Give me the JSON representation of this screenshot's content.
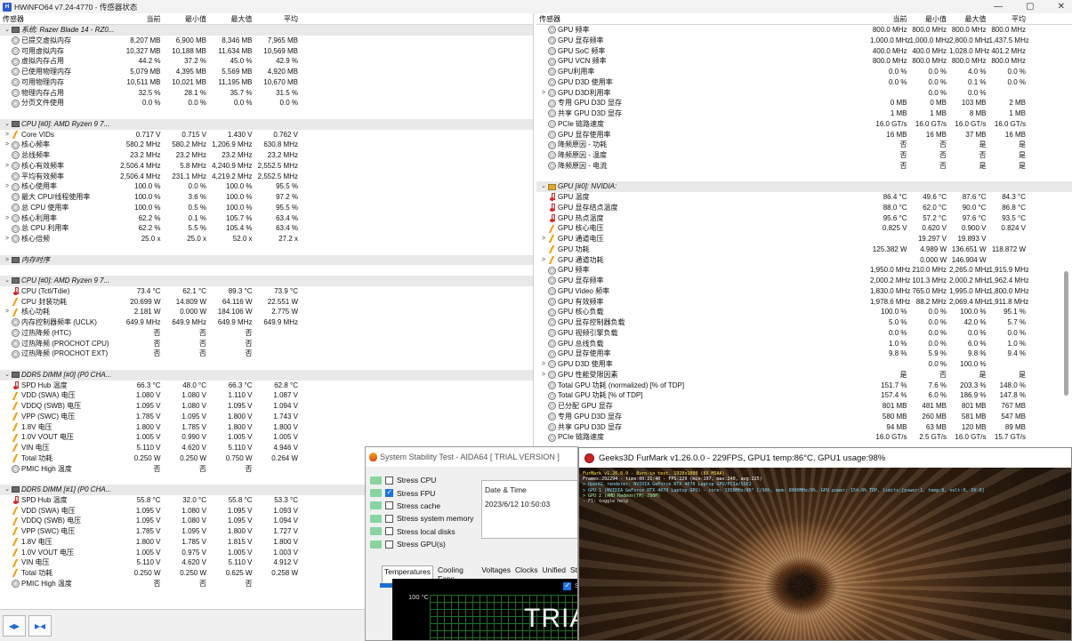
{
  "titlebar": {
    "app_title": "HWiNFO64 v7.24-4770 - 传感器状态",
    "minimize": "—",
    "maximize": "▢",
    "close": "✕"
  },
  "columns": {
    "name": "传感器",
    "current": "当前",
    "min": "最小值",
    "max": "最大值",
    "avg": "平均"
  },
  "left_rows": [
    {
      "type": "section",
      "name": "系统: Razer Blade 14 - RZ0..."
    },
    {
      "icon": "circle",
      "name": "已提交虚拟内存",
      "v": [
        "8,207 MB",
        "6,900 MB",
        "8,346 MB",
        "7,965 MB"
      ]
    },
    {
      "icon": "circle",
      "name": "可用虚拟内存",
      "v": [
        "10,327 MB",
        "10,188 MB",
        "11,634 MB",
        "10,569 MB"
      ]
    },
    {
      "icon": "circle",
      "name": "虚拟内存占用",
      "v": [
        "44.2 %",
        "37.2 %",
        "45.0 %",
        "42.9 %"
      ]
    },
    {
      "icon": "circle",
      "name": "已使用物理内存",
      "v": [
        "5,079 MB",
        "4,395 MB",
        "5,569 MB",
        "4,920 MB"
      ]
    },
    {
      "icon": "circle",
      "name": "可用物理内存",
      "v": [
        "10,511 MB",
        "10,021 MB",
        "11,195 MB",
        "10,670 MB"
      ]
    },
    {
      "icon": "circle",
      "name": "物理内存占用",
      "v": [
        "32.5 %",
        "28.1 %",
        "35.7 %",
        "31.5 %"
      ]
    },
    {
      "icon": "circle",
      "name": "分页文件使用",
      "v": [
        "0.0 %",
        "0.0 %",
        "0.0 %",
        "0.0 %"
      ]
    },
    {
      "type": "blank"
    },
    {
      "type": "section",
      "name": "CPU [#0]: AMD Ryzen 9 7..."
    },
    {
      "exp": ">",
      "icon": "bolt",
      "name": "Core VIDs",
      "v": [
        "0.717 V",
        "0.715 V",
        "1.430 V",
        "0.762 V"
      ]
    },
    {
      "exp": ">",
      "icon": "circle",
      "name": "核心频率",
      "v": [
        "580.2 MHz",
        "580.2 MHz",
        "1,206.9 MHz",
        "630.8 MHz"
      ]
    },
    {
      "icon": "circle",
      "name": "总线频率",
      "v": [
        "23.2 MHz",
        "23.2 MHz",
        "23.2 MHz",
        "23.2 MHz"
      ]
    },
    {
      "exp": ">",
      "icon": "circle",
      "name": "核心有效频率",
      "v": [
        "2,506.4 MHz",
        "5.8 MHz",
        "4,240.9 MHz",
        "2,552.5 MHz"
      ]
    },
    {
      "icon": "circle",
      "name": "平均有效频率",
      "v": [
        "2,506.4 MHz",
        "231.1 MHz",
        "4,219.2 MHz",
        "2,552.5 MHz"
      ]
    },
    {
      "exp": ">",
      "icon": "circle",
      "name": "核心使用率",
      "v": [
        "100.0 %",
        "0.0 %",
        "100.0 %",
        "95.5 %"
      ]
    },
    {
      "icon": "circle",
      "name": "最大 CPU/线程使用率",
      "v": [
        "100.0 %",
        "3.6 %",
        "100.0 %",
        "97.2 %"
      ]
    },
    {
      "icon": "circle",
      "name": "总 CPU 使用率",
      "v": [
        "100.0 %",
        "0.5 %",
        "100.0 %",
        "95.5 %"
      ]
    },
    {
      "exp": ">",
      "icon": "circle",
      "name": "核心利用率",
      "v": [
        "62.2 %",
        "0.1 %",
        "105.7 %",
        "63.4 %"
      ]
    },
    {
      "icon": "circle",
      "name": "总 CPU 利用率",
      "v": [
        "62.2 %",
        "5.5 %",
        "105.4 %",
        "63.4 %"
      ]
    },
    {
      "exp": ">",
      "icon": "circle",
      "name": "核心倍频",
      "v": [
        "25.0 x",
        "25.0 x",
        "52.0 x",
        "27.2 x"
      ]
    },
    {
      "type": "blank"
    },
    {
      "type": "section",
      "exp": ">",
      "icon": "mem",
      "name": "内存时序"
    },
    {
      "type": "blank"
    },
    {
      "type": "section",
      "name": "CPU [#0]: AMD Ryzen 9 7..."
    },
    {
      "icon": "thermo",
      "name": "CPU (Tctl/Tdie)",
      "v": [
        "73.4 °C",
        "62.1 °C",
        "89.3 °C",
        "73.9 °C"
      ]
    },
    {
      "icon": "bolt",
      "name": "CPU 封装功耗",
      "v": [
        "20.699 W",
        "14.809 W",
        "64.116 W",
        "22.551 W"
      ]
    },
    {
      "exp": ">",
      "icon": "bolt",
      "name": "核心功耗",
      "v": [
        "2.181 W",
        "0.000 W",
        "184.106 W",
        "2.775 W"
      ]
    },
    {
      "icon": "circle",
      "name": "内存控制器频率 (UCLK)",
      "v": [
        "649.9 MHz",
        "649.9 MHz",
        "649.9 MHz",
        "649.9 MHz"
      ]
    },
    {
      "icon": "circle",
      "name": "过热降频 (HTC)",
      "v": [
        "否",
        "否",
        "否",
        ""
      ]
    },
    {
      "icon": "circle",
      "name": "过热降频 (PROCHOT CPU)",
      "v": [
        "否",
        "否",
        "否",
        ""
      ]
    },
    {
      "icon": "circle",
      "name": "过热降频 (PROCHOT EXT)",
      "v": [
        "否",
        "否",
        "否",
        ""
      ]
    },
    {
      "type": "blank"
    },
    {
      "type": "section",
      "name": "DDR5 DIMM [#0] (P0 CHA..."
    },
    {
      "icon": "thermo",
      "name": "SPD Hub 温度",
      "v": [
        "66.3 °C",
        "48.0 °C",
        "66.3 °C",
        "62.8 °C"
      ]
    },
    {
      "icon": "bolt",
      "name": "VDD (SWA) 电压",
      "v": [
        "1.080 V",
        "1.080 V",
        "1.110 V",
        "1.087 V"
      ]
    },
    {
      "icon": "bolt",
      "name": "VDDQ (SWB) 电压",
      "v": [
        "1.095 V",
        "1.080 V",
        "1.095 V",
        "1.094 V"
      ]
    },
    {
      "icon": "bolt",
      "name": "VPP (SWC) 电压",
      "v": [
        "1.785 V",
        "1.095 V",
        "1.800 V",
        "1.743 V"
      ]
    },
    {
      "icon": "bolt",
      "name": "1.8V 电压",
      "v": [
        "1.800 V",
        "1.785 V",
        "1.800 V",
        "1.800 V"
      ]
    },
    {
      "icon": "bolt",
      "name": "1.0V VOUT 电压",
      "v": [
        "1.005 V",
        "0.990 V",
        "1.005 V",
        "1.005 V"
      ]
    },
    {
      "icon": "bolt",
      "name": "VIN 电压",
      "v": [
        "5.110 V",
        "4.620 V",
        "5.110 V",
        "4.946 V"
      ]
    },
    {
      "icon": "bolt",
      "name": "Total 功耗",
      "v": [
        "0.250 W",
        "0.250 W",
        "0.750 W",
        "0.264 W"
      ]
    },
    {
      "icon": "circle",
      "name": "PMIC High 温度",
      "v": [
        "否",
        "否",
        "否",
        ""
      ]
    },
    {
      "type": "blank"
    },
    {
      "type": "section",
      "name": "DDR5 DIMM [#1] (P0 CHA..."
    },
    {
      "icon": "thermo",
      "name": "SPD Hub 温度",
      "v": [
        "55.8 °C",
        "32.0 °C",
        "55.8 °C",
        "53.3 °C"
      ]
    },
    {
      "icon": "bolt",
      "name": "VDD (SWA) 电压",
      "v": [
        "1.095 V",
        "1.080 V",
        "1.095 V",
        "1.093 V"
      ]
    },
    {
      "icon": "bolt",
      "name": "VDDQ (SWB) 电压",
      "v": [
        "1.095 V",
        "1.080 V",
        "1.095 V",
        "1.094 V"
      ]
    },
    {
      "icon": "bolt",
      "name": "VPP (SWC) 电压",
      "v": [
        "1.785 V",
        "1.095 V",
        "1.800 V",
        "1.727 V"
      ]
    },
    {
      "icon": "bolt",
      "name": "1.8V 电压",
      "v": [
        "1.800 V",
        "1.785 V",
        "1.815 V",
        "1.800 V"
      ]
    },
    {
      "icon": "bolt",
      "name": "1.0V VOUT 电压",
      "v": [
        "1.005 V",
        "0.975 V",
        "1.005 V",
        "1.003 V"
      ]
    },
    {
      "icon": "bolt",
      "name": "VIN 电压",
      "v": [
        "5.110 V",
        "4.620 V",
        "5.110 V",
        "4.912 V"
      ]
    },
    {
      "icon": "bolt",
      "name": "Total 功耗",
      "v": [
        "0.250 W",
        "0.250 W",
        "0.625 W",
        "0.258 W"
      ]
    },
    {
      "icon": "circle",
      "name": "PMIC High 温度",
      "v": [
        "否",
        "否",
        "否",
        ""
      ]
    }
  ],
  "right_rows": [
    {
      "icon": "circle",
      "name": "GPU 频率",
      "v": [
        "800.0 MHz",
        "800.0 MHz",
        "800.0 MHz",
        "800.0 MHz"
      ]
    },
    {
      "icon": "circle",
      "name": "GPU 显存频率",
      "v": [
        "1,000.0 MHz",
        "1,000.0 MHz",
        "2,800.0 MHz",
        "1,437.5 MHz"
      ]
    },
    {
      "icon": "circle",
      "name": "GPU SoC 频率",
      "v": [
        "400.0 MHz",
        "400.0 MHz",
        "1,028.0 MHz",
        "401.2 MHz"
      ]
    },
    {
      "icon": "circle",
      "name": "GPU VCN 频率",
      "v": [
        "800.0 MHz",
        "800.0 MHz",
        "800.0 MHz",
        "800.0 MHz"
      ]
    },
    {
      "icon": "circle",
      "name": "GPU利用率",
      "v": [
        "0.0 %",
        "0.0 %",
        "4.0 %",
        "0.0 %"
      ]
    },
    {
      "icon": "circle",
      "name": "GPU D3D 使用率",
      "v": [
        "0.0 %",
        "0.0 %",
        "0.1 %",
        "0.0 %"
      ]
    },
    {
      "exp": ">",
      "icon": "circle",
      "name": "GPU D3D利用率",
      "v": [
        "",
        "0.0 %",
        "0.0 %",
        ""
      ]
    },
    {
      "icon": "circle",
      "name": "专用 GPU D3D 显存",
      "v": [
        "0 MB",
        "0 MB",
        "103 MB",
        "2 MB"
      ]
    },
    {
      "icon": "circle",
      "name": "共享 GPU D3D 显存",
      "v": [
        "1 MB",
        "1 MB",
        "8 MB",
        "1 MB"
      ]
    },
    {
      "icon": "circle",
      "name": "PCIe 链路速度",
      "v": [
        "16.0 GT/s",
        "16.0 GT/s",
        "16.0 GT/s",
        "16.0 GT/s"
      ]
    },
    {
      "icon": "circle",
      "name": "GPU 显存使用率",
      "v": [
        "16 MB",
        "16 MB",
        "37 MB",
        "16 MB"
      ]
    },
    {
      "icon": "circle",
      "name": "降频原因 - 功耗",
      "v": [
        "否",
        "否",
        "是",
        "是"
      ]
    },
    {
      "icon": "circle",
      "name": "降频原因 - 温度",
      "v": [
        "否",
        "否",
        "否",
        "是"
      ]
    },
    {
      "icon": "circle",
      "name": "降频原因 - 电流",
      "v": [
        "否",
        "否",
        "是",
        "是"
      ]
    },
    {
      "type": "blank"
    },
    {
      "type": "section",
      "exp": "v",
      "icon": "fold",
      "name": "GPU [#0]: NVIDIA:"
    },
    {
      "icon": "thermo",
      "name": "GPU 温度",
      "v": [
        "86.4 °C",
        "49.6 °C",
        "87.6 °C",
        "84.3 °C"
      ]
    },
    {
      "icon": "thermo",
      "name": "GPU 显存结点温度",
      "v": [
        "88.0 °C",
        "62.0 °C",
        "90.0 °C",
        "86.8 °C"
      ]
    },
    {
      "icon": "thermo",
      "name": "GPU 热点温度",
      "v": [
        "95.6 °C",
        "57.2 °C",
        "97.6 °C",
        "93.5 °C"
      ]
    },
    {
      "icon": "bolt",
      "name": "GPU 核心电压",
      "v": [
        "0.825 V",
        "0.620 V",
        "0.900 V",
        "0.824 V"
      ]
    },
    {
      "exp": ">",
      "icon": "bolt",
      "name": "GPU 通道电压",
      "v": [
        "",
        "19.297 V",
        "19.893 V",
        ""
      ]
    },
    {
      "icon": "bolt",
      "name": "GPU 功耗",
      "v": [
        "125.382 W",
        "4.989 W",
        "136.651 W",
        "118.872 W"
      ]
    },
    {
      "exp": ">",
      "icon": "bolt",
      "name": "GPU 通道功耗",
      "v": [
        "",
        "0.000 W",
        "146.904 W",
        ""
      ]
    },
    {
      "icon": "circle",
      "name": "GPU 频率",
      "v": [
        "1,950.0 MHz",
        "210.0 MHz",
        "2,265.0 MHz",
        "1,915.9 MHz"
      ]
    },
    {
      "icon": "circle",
      "name": "GPU 显存频率",
      "v": [
        "2,000.2 MHz",
        "101.3 MHz",
        "2,000.2 MHz",
        "1,962.4 MHz"
      ]
    },
    {
      "icon": "circle",
      "name": "GPU Video 频率",
      "v": [
        "1,830.0 MHz",
        "765.0 MHz",
        "1,995.0 MHz",
        "1,800.0 MHz"
      ]
    },
    {
      "icon": "circle",
      "name": "GPU 有效频率",
      "v": [
        "1,978.6 MHz",
        "88.2 MHz",
        "2,069.4 MHz",
        "1,911.8 MHz"
      ]
    },
    {
      "icon": "circle",
      "name": "GPU 核心负载",
      "v": [
        "100.0 %",
        "0.0 %",
        "100.0 %",
        "95.1 %"
      ]
    },
    {
      "icon": "circle",
      "name": "GPU 显存控制器负载",
      "v": [
        "5.0 %",
        "0.0 %",
        "42.0 %",
        "5.7 %"
      ]
    },
    {
      "icon": "circle",
      "name": "GPU 视频引擎负载",
      "v": [
        "0.0 %",
        "0.0 %",
        "0.0 %",
        "0.0 %"
      ]
    },
    {
      "icon": "circle",
      "name": "GPU 总线负载",
      "v": [
        "1.0 %",
        "0.0 %",
        "6.0 %",
        "1.0 %"
      ]
    },
    {
      "icon": "circle",
      "name": "GPU 显存使用率",
      "v": [
        "9.8 %",
        "5.9 %",
        "9.8 %",
        "9.4 %"
      ]
    },
    {
      "exp": ">",
      "icon": "circle",
      "name": "GPU D3D 使用率",
      "v": [
        "",
        "0.0 %",
        "100.0 %",
        ""
      ]
    },
    {
      "exp": ">",
      "icon": "circle",
      "name": "GPU 性能受限因素",
      "v": [
        "是",
        "否",
        "是",
        "是"
      ]
    },
    {
      "icon": "circle",
      "name": "Total GPU 功耗 (normalized) [% of TDP]",
      "v": [
        "151.7 %",
        "7.6 %",
        "203.3 %",
        "148.0 %"
      ]
    },
    {
      "icon": "circle",
      "name": "Total GPU 功耗 [% of TDP]",
      "v": [
        "157.4 %",
        "6.0 %",
        "186.9 %",
        "147.8 %"
      ]
    },
    {
      "icon": "circle",
      "name": "已分配 GPU 显存",
      "v": [
        "801 MB",
        "481 MB",
        "801 MB",
        "767 MB"
      ]
    },
    {
      "icon": "circle",
      "name": "专用 GPU D3D 显存",
      "v": [
        "580 MB",
        "260 MB",
        "581 MB",
        "547 MB"
      ]
    },
    {
      "icon": "circle",
      "name": "共享 GPU D3D 显存",
      "v": [
        "94 MB",
        "63 MB",
        "120 MB",
        "89 MB"
      ]
    },
    {
      "icon": "circle",
      "name": "PCIe 链路速度",
      "v": [
        "16.0 GT/s",
        "2.5 GT/s",
        "16.0 GT/s",
        "15.7 GT/s"
      ]
    }
  ],
  "toolbar": {
    "btn1": "◂▸",
    "btn2": "▸◂"
  },
  "aida": {
    "title": "System Stability Test - AIDA64  [ TRIAL VERSION ]",
    "items": [
      {
        "label": "Stress CPU",
        "checked": false
      },
      {
        "label": "Stress FPU",
        "checked": true
      },
      {
        "label": "Stress cache",
        "checked": false
      },
      {
        "label": "Stress system memory",
        "checked": false
      },
      {
        "label": "Stress local disks",
        "checked": false
      },
      {
        "label": "Stress GPU(s)",
        "checked": false
      }
    ],
    "date_label": "Date & Time",
    "date_value": "2023/6/12 10:50:03",
    "tabs": [
      "Temperatures",
      "Cooling Fans",
      "Voltages",
      "Clocks",
      "Unified",
      "St"
    ],
    "graph_ylabel": "100 °C",
    "graph_watermark": "TRIA",
    "graph_checkbox_label": "SA"
  },
  "furmark": {
    "title": "Geeks3D FurMark v1.26.0.0 - 229FPS, GPU1 temp:86°C, GPU1 usage:98%",
    "osd": [
      "FurMark v1.26.0.0 - Burn-in test, 1920x1080 (8X MSAA)",
      "Frames:292294 - time:00:21:40 - FPS:229 (min:197, max:240, avg:225)",
      "> OpenGL renderer: NVIDIA GeForce RTX 4070 Laptop GPU/PCIe/SSE2",
      "> GPU 1 (NVIDIA GeForce RTX 4070 Laptop GPU) - core: 1950MHz/86° C/98%, mem: 8000MHz/9%, GPU power: 154.8% TDP, limits:[power:1, temp:0, volt:0, OV:0]",
      "> GPU 2 (AMD Radeon(TM) 780M)",
      "- F1: toggle help"
    ]
  }
}
